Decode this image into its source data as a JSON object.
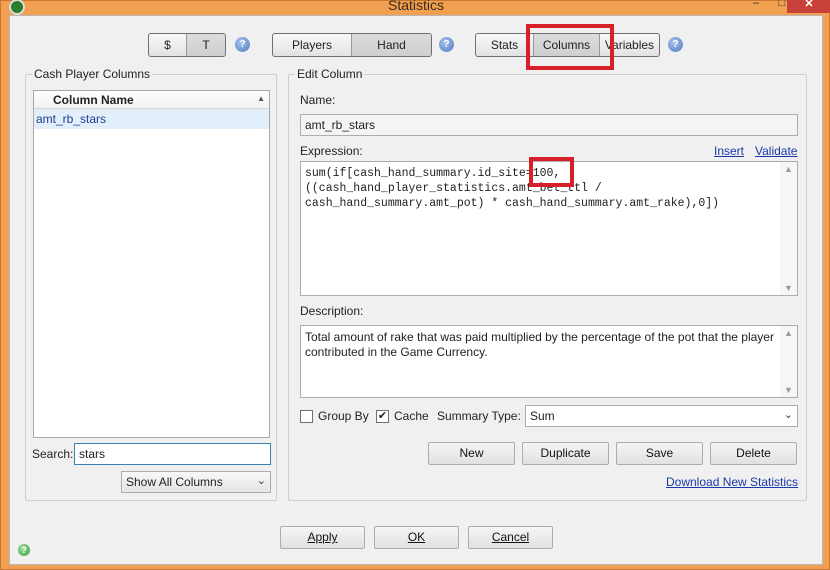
{
  "window": {
    "title": "Statistics",
    "close_glyph": "✕",
    "min_glyph": "–",
    "max_glyph": "□"
  },
  "toggles": {
    "currency": [
      "$",
      "T"
    ],
    "scope": [
      "Players",
      "Hand"
    ],
    "mode": [
      "Stats",
      "Columns",
      "Variables"
    ],
    "help_glyph": "?"
  },
  "left_panel": {
    "title": "Cash Player Columns",
    "column_header": "Column Name",
    "items": [
      "amt_rb_stars"
    ],
    "search_label": "Search:",
    "search_value": "stars",
    "filter_value": "Show All Columns"
  },
  "edit_column": {
    "title": "Edit Column",
    "name_label": "Name:",
    "name_value": "amt_rb_stars",
    "expression_label": "Expression:",
    "insert_link": "Insert",
    "validate_link": "Validate",
    "expression_value": "sum(if[cash_hand_summary.id_site=100,\n((cash_hand_player_statistics.amt_bet_ttl /\ncash_hand_summary.amt_pot) * cash_hand_summary.amt_rake),0])",
    "description_label": "Description:",
    "description_value": "Total amount of rake that was paid multiplied by the percentage of the pot that the player contributed in the Game Currency.",
    "group_by_label": "Group By",
    "group_by_checked": false,
    "cache_label": "Cache",
    "cache_checked": true,
    "summary_type_label": "Summary Type:",
    "summary_type_value": "Sum",
    "buttons": {
      "new": "New",
      "duplicate": "Duplicate",
      "save": "Save",
      "delete": "Delete"
    },
    "download_link": "Download New Statistics"
  },
  "footer": {
    "apply": "Apply",
    "ok": "OK",
    "cancel": "Cancel"
  },
  "colors": {
    "highlight": "#d8202a",
    "link": "#1a3aa8",
    "frame": "#f0a050"
  }
}
